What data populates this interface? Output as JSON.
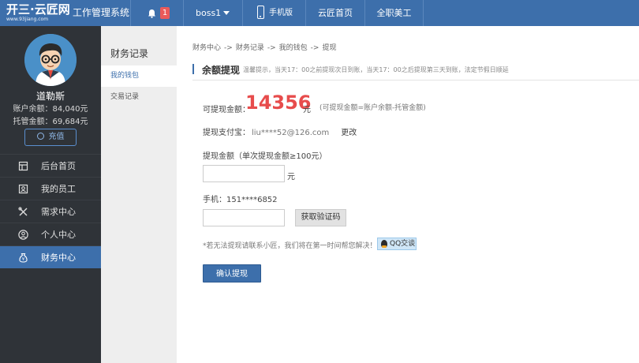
{
  "topbar": {
    "logo_text": "开三·云匠网",
    "logo_sub": "www.93jiang.com",
    "app_title": "工作管理系统",
    "notification_count": "1",
    "username": "boss1",
    "phone_label": "手机版",
    "home_label": "云匠首页",
    "fulltime_label": "全职美工",
    "brand_color": "#3d6fab"
  },
  "sidebar": {
    "user_name": "道勒斯",
    "account_balance": "账户余额：84,040元",
    "escrow_amount": "托管金额：69,684元",
    "recharge_label": "充值",
    "items": [
      {
        "label": "后台首页",
        "icon": "home-icon"
      },
      {
        "label": "我的员工",
        "icon": "staff-icon"
      },
      {
        "label": "需求中心",
        "icon": "tools-icon"
      },
      {
        "label": "个人中心",
        "icon": "user-icon"
      },
      {
        "label": "财务中心",
        "icon": "money-bag-icon"
      }
    ]
  },
  "subnav": {
    "title": "财务记录",
    "items": [
      {
        "label": "我的钱包"
      },
      {
        "label": "交易记录"
      }
    ]
  },
  "breadcrumb": {
    "items": [
      "财务中心",
      "财务记录",
      "我的钱包",
      "提现"
    ],
    "separator": "->"
  },
  "section": {
    "title": "余额提现",
    "tip": "温馨提示，当天17：00之前提现次日到账，当天17：00之后提现第三天到账，法定节假日顺延"
  },
  "form": {
    "available_label": "可提现金额：",
    "available_amount": "14356",
    "amount_unit": "元",
    "available_note": "(可提现金额=账户余额-托管金额)",
    "alipay_label": "提现支付宝：",
    "alipay_account": "liu****52@126.com",
    "change_label": "更改",
    "withdraw_label": "提现金额（单次提现金额≥100元）",
    "withdraw_value": "",
    "yuan": "元",
    "phone_label": "手机：151****6852",
    "code_value": "",
    "get_code_label": "获取验证码",
    "help_text": "*若无法提现请联系小匠，我们将在第一时间帮您解决！",
    "qq_label": "QQ交谈",
    "confirm_label": "确认提现"
  }
}
